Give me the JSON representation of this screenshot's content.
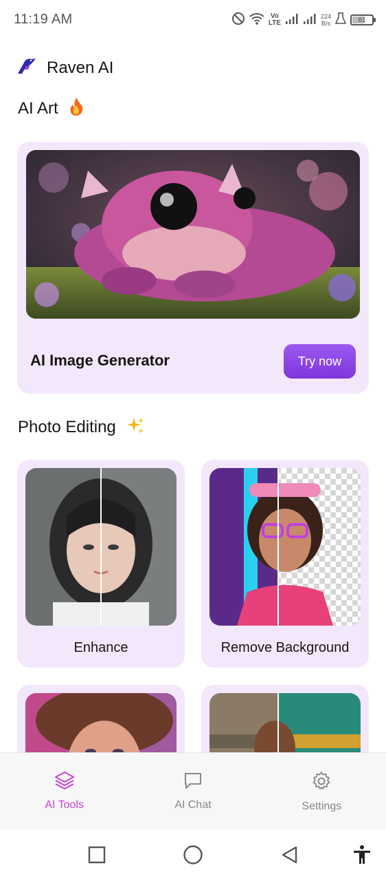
{
  "status_bar": {
    "time": "11:19 AM",
    "network_speed_value": "224",
    "network_speed_unit": "B/s",
    "volte_top": "Vo",
    "volte_bottom": "LTE",
    "battery_level": "61",
    "icons": [
      "do-not-disturb-icon",
      "wifi-icon",
      "signal-icon",
      "signal-icon",
      "lab-icon",
      "battery-icon"
    ]
  },
  "header": {
    "app_name": "Raven AI",
    "logo_icon": "raven-logo-icon"
  },
  "ai_art": {
    "title": "AI Art",
    "title_emoji": "🔥",
    "hero": {
      "label": "AI Image Generator",
      "button_label": "Try now",
      "image": "pink-baby-dragon-illustration"
    }
  },
  "photo_editing": {
    "title": "Photo Editing",
    "title_emoji": "✨",
    "tools": [
      {
        "label": "Enhance",
        "image": "portrait-before-after"
      },
      {
        "label": "Remove Background",
        "image": "girl-with-goggles-transparent-bg"
      },
      {
        "label": "",
        "image": "curly-hair-portrait"
      },
      {
        "label": "",
        "image": "colorized-photo-before-after"
      }
    ]
  },
  "bottom_nav": {
    "items": [
      {
        "label": "AI Tools",
        "icon": "layers-icon",
        "active": true
      },
      {
        "label": "AI Chat",
        "icon": "chat-bubble-icon",
        "active": false
      },
      {
        "label": "Settings",
        "icon": "gear-icon",
        "active": false
      }
    ]
  },
  "system_nav": [
    "recents-square-icon",
    "home-circle-icon",
    "back-triangle-icon",
    "accessibility-icon"
  ],
  "colors": {
    "card_bg": "#f3e7fb",
    "accent": "#c83fd6",
    "button": "#8b45e8"
  }
}
